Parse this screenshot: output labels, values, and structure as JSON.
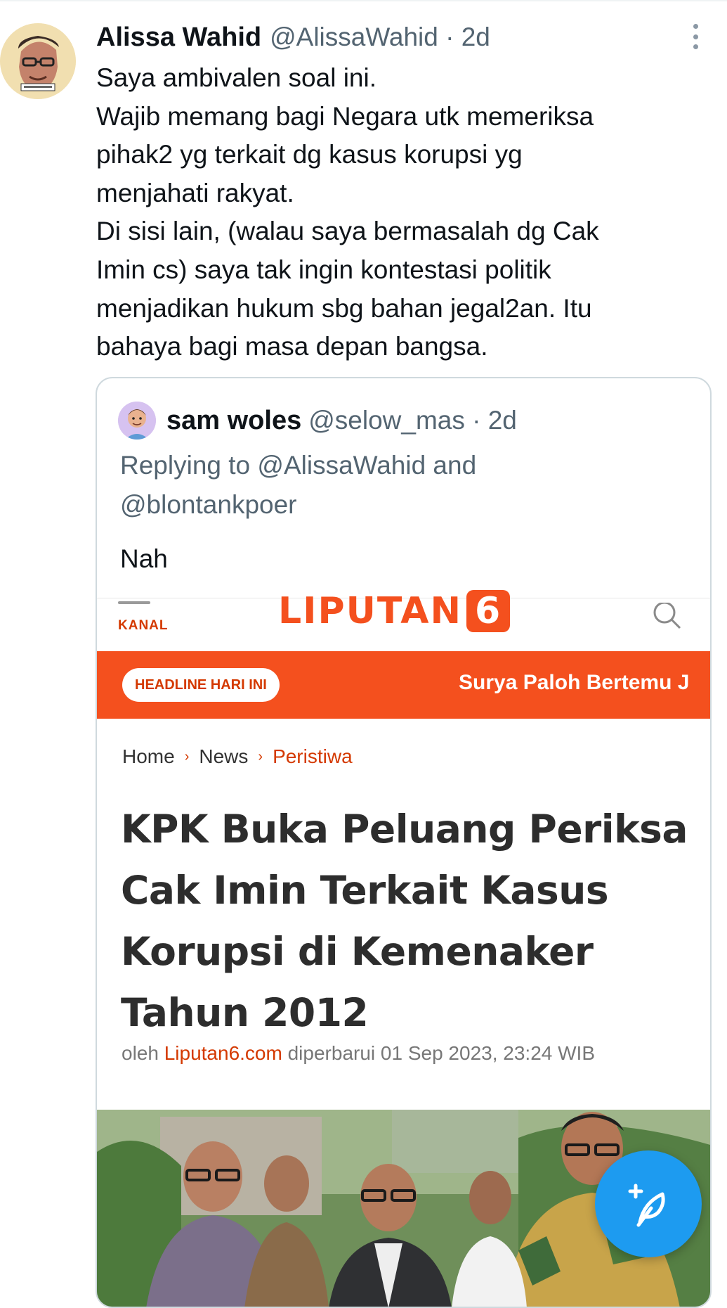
{
  "tweet": {
    "author_name": "Alissa Wahid",
    "author_meta": "@AlissaWahid · 2d",
    "lines": [
      "Saya ambivalen soal ini.",
      "Wajib memang bagi Negara utk memeriksa",
      "pihak2 yg terkait dg kasus korupsi yg",
      "menjahati rakyat.",
      "Di sisi lain, (walau saya bermasalah dg Cak",
      "Imin cs) saya tak ingin  kontestasi politik",
      "menjadikan hukum sbg bahan jegal2an. Itu",
      "bahaya bagi masa depan bangsa."
    ]
  },
  "quote": {
    "author_name": "sam woles",
    "author_meta": "@selow_mas · 2d",
    "replying_lines": [
      "Replying to @AlissaWahid and",
      "@blontankpoer"
    ],
    "text": "Nah"
  },
  "article": {
    "kanal_label": "KANAL",
    "logo_text": "LIPUTAN",
    "logo_number": "6",
    "headline_pill": "HEADLINE HARI INI",
    "ticker_text": "Surya Paloh Bertemu J",
    "breadcrumb": {
      "home": "Home",
      "news": "News",
      "current": "Peristiwa",
      "separator": "›"
    },
    "title_lines": [
      "KPK Buka Peluang Periksa",
      "Cak Imin Terkait Kasus",
      "Korupsi di Kemenaker",
      "Tahun 2012"
    ],
    "byline": {
      "prefix": "oleh",
      "site": "Liputan6.com",
      "updated": "diperbarui 01 Sep 2023, 23:24 WIB"
    }
  },
  "colors": {
    "twitter_blue": "#1d9bf0",
    "text_primary": "#0f1419",
    "text_secondary": "#536471",
    "liputan_orange": "#f4501e"
  },
  "icons": {
    "more": "more-vertical-icon",
    "compose": "compose-feather-icon",
    "search": "search-icon",
    "menu": "hamburger-menu-icon"
  }
}
